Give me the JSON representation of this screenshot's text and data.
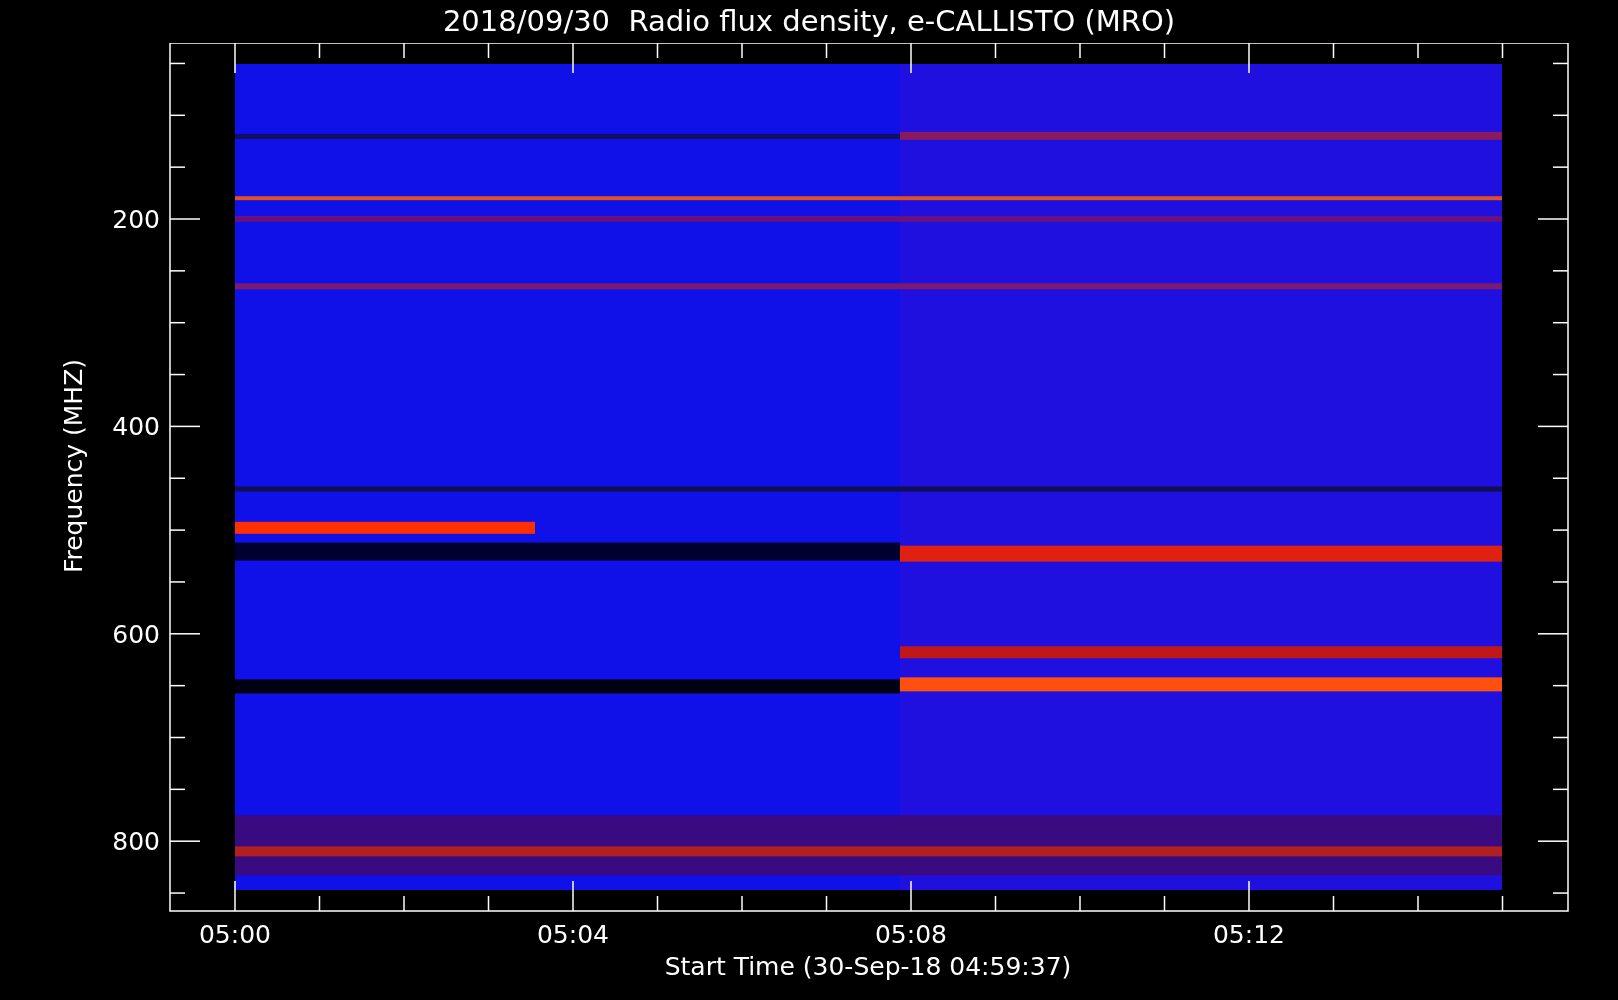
{
  "title": "2018/09/30  Radio flux density, e-CALLISTO (MRO)",
  "y_axis": {
    "label": "Frequency (MHZ)",
    "ticks": [
      "200",
      "400",
      "600",
      "800"
    ]
  },
  "x_axis": {
    "label": "Start Time (30-Sep-18 04:59:37)",
    "ticks": [
      "05:00",
      "05:04",
      "05:08",
      "05:12"
    ]
  }
}
